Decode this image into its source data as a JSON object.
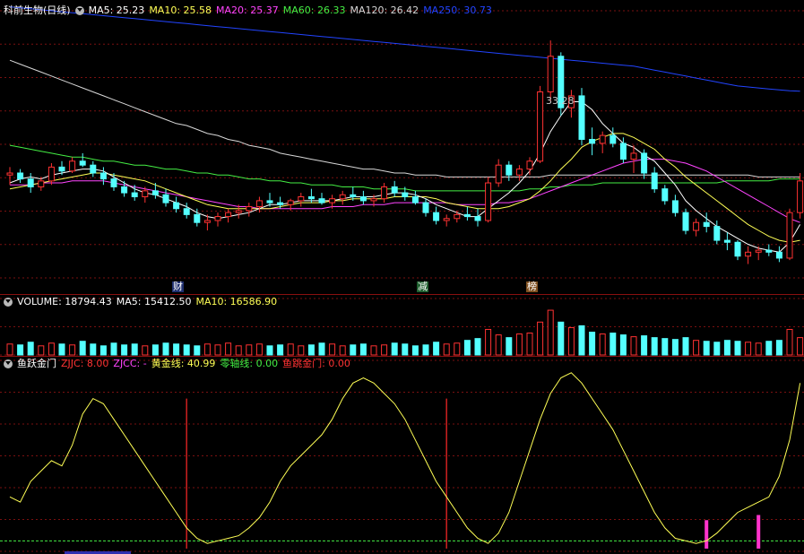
{
  "title": "科前生物(日线)",
  "ma_header": [
    {
      "label": "MA5: 25.23",
      "color": "#ffffff"
    },
    {
      "label": "MA10: 25.58",
      "color": "#ffff55"
    },
    {
      "label": "MA20: 25.37",
      "color": "#ff44ff"
    },
    {
      "label": "MA60: 26.33",
      "color": "#44ee44"
    },
    {
      "label": "MA120: 26.42",
      "color": "#d8d8d8"
    },
    {
      "label": "MA250: 30.73",
      "color": "#2244ff"
    }
  ],
  "volume_header": [
    {
      "label": "VOLUME: 18794.43",
      "color": "#ffffff"
    },
    {
      "label": "MA5: 15412.50",
      "color": "#ffffff"
    },
    {
      "label": "MA10: 16586.90",
      "color": "#ffff55"
    }
  ],
  "indicator_header": [
    {
      "label": "鱼跃金门",
      "color": "#ffffff"
    },
    {
      "label": "ZJJC: 8.00",
      "color": "#ff3333"
    },
    {
      "label": "ZJCC: -",
      "color": "#ff44ff"
    },
    {
      "label": "黄金线: 40.99",
      "color": "#ffff55"
    },
    {
      "label": "零轴线: 0.00",
      "color": "#44ee44"
    },
    {
      "label": "鱼跳金门: 0.00",
      "color": "#ff3333"
    }
  ],
  "high_label": "33.28",
  "events": [
    {
      "label": "财",
      "bg": "#1f2f6f",
      "color": "#ffffff"
    },
    {
      "label": "减",
      "bg": "#1f5f2f",
      "color": "#ffffff"
    },
    {
      "label": "榜",
      "bg": "#7f4f1f",
      "color": "#ffffff"
    }
  ],
  "colors": {
    "up": "#ff3232",
    "down": "#54ffff",
    "grid": "#7a1010",
    "ma5": "#ffffff",
    "ma10": "#ffff55",
    "ma20": "#ff44ff",
    "ma60": "#44ee44",
    "ma120": "#d8d8d8",
    "ma250": "#2244ff"
  },
  "chart_data": {
    "type": "candlestick",
    "price_range": [
      21.3,
      34.8
    ],
    "candles": [
      [
        26.5,
        26.9,
        26.0,
        26.6
      ],
      [
        26.6,
        26.8,
        26.1,
        26.3
      ],
      [
        26.3,
        26.6,
        25.6,
        25.9
      ],
      [
        25.9,
        26.4,
        25.7,
        26.2
      ],
      [
        26.2,
        27.1,
        26.0,
        26.9
      ],
      [
        26.9,
        27.2,
        26.5,
        26.7
      ],
      [
        26.7,
        27.4,
        26.6,
        27.2
      ],
      [
        27.2,
        27.6,
        26.9,
        27.0
      ],
      [
        27.0,
        27.2,
        26.4,
        26.6
      ],
      [
        26.6,
        26.9,
        26.0,
        26.3
      ],
      [
        26.3,
        26.6,
        25.7,
        25.9
      ],
      [
        25.9,
        26.2,
        25.4,
        25.6
      ],
      [
        25.6,
        26.0,
        25.2,
        25.4
      ],
      [
        25.4,
        25.9,
        25.1,
        25.7
      ],
      [
        25.7,
        26.1,
        25.3,
        25.5
      ],
      [
        25.5,
        25.8,
        24.9,
        25.1
      ],
      [
        25.1,
        25.4,
        24.6,
        24.8
      ],
      [
        24.8,
        25.1,
        24.3,
        24.5
      ],
      [
        24.5,
        24.8,
        23.9,
        24.1
      ],
      [
        24.1,
        24.5,
        23.7,
        24.2
      ],
      [
        24.2,
        24.6,
        23.9,
        24.4
      ],
      [
        24.4,
        24.8,
        24.1,
        24.6
      ],
      [
        24.6,
        25.0,
        24.3,
        24.7
      ],
      [
        24.7,
        25.1,
        24.4,
        24.9
      ],
      [
        24.9,
        25.4,
        24.6,
        25.2
      ],
      [
        25.2,
        25.6,
        24.9,
        25.1
      ],
      [
        25.1,
        25.4,
        24.8,
        25.0
      ],
      [
        25.0,
        25.3,
        24.7,
        25.2
      ],
      [
        25.2,
        25.6,
        24.9,
        25.4
      ],
      [
        25.4,
        25.8,
        25.1,
        25.3
      ],
      [
        25.3,
        25.6,
        25.0,
        25.1
      ],
      [
        25.1,
        25.5,
        24.8,
        25.3
      ],
      [
        25.3,
        25.7,
        25.0,
        25.5
      ],
      [
        25.5,
        25.9,
        25.2,
        25.4
      ],
      [
        25.4,
        25.7,
        25.0,
        25.2
      ],
      [
        25.2,
        25.5,
        24.9,
        25.3
      ],
      [
        25.3,
        26.1,
        25.1,
        25.9
      ],
      [
        25.9,
        26.2,
        25.4,
        25.6
      ],
      [
        25.6,
        25.9,
        25.2,
        25.4
      ],
      [
        25.4,
        25.7,
        25.0,
        25.1
      ],
      [
        25.1,
        25.3,
        24.4,
        24.6
      ],
      [
        24.6,
        24.9,
        24.0,
        24.2
      ],
      [
        24.2,
        24.5,
        23.9,
        24.3
      ],
      [
        24.3,
        24.7,
        24.1,
        24.5
      ],
      [
        24.5,
        24.9,
        24.2,
        24.4
      ],
      [
        24.4,
        24.8,
        23.9,
        24.2
      ],
      [
        24.2,
        26.4,
        24.1,
        26.1
      ],
      [
        26.1,
        27.3,
        25.9,
        27.0
      ],
      [
        27.0,
        27.2,
        26.2,
        26.5
      ],
      [
        26.5,
        27.0,
        26.2,
        26.8
      ],
      [
        26.8,
        27.4,
        26.5,
        27.2
      ],
      [
        27.2,
        31.0,
        27.1,
        30.7
      ],
      [
        30.7,
        33.3,
        30.2,
        32.5
      ],
      [
        32.5,
        32.7,
        29.5,
        29.9
      ],
      [
        29.9,
        30.8,
        29.4,
        30.5
      ],
      [
        30.5,
        30.9,
        28.0,
        28.3
      ],
      [
        28.3,
        28.9,
        27.5,
        28.1
      ],
      [
        28.1,
        28.7,
        27.6,
        28.5
      ],
      [
        28.5,
        28.9,
        27.9,
        28.1
      ],
      [
        28.1,
        28.4,
        27.1,
        27.3
      ],
      [
        27.3,
        28.0,
        26.6,
        27.6
      ],
      [
        27.6,
        27.8,
        26.3,
        26.6
      ],
      [
        26.6,
        26.9,
        25.6,
        25.8
      ],
      [
        25.8,
        26.0,
        25.0,
        25.2
      ],
      [
        25.2,
        25.5,
        24.4,
        24.6
      ],
      [
        24.6,
        24.8,
        23.5,
        23.7
      ],
      [
        23.7,
        24.3,
        23.4,
        24.1
      ],
      [
        24.1,
        24.6,
        23.6,
        23.9
      ],
      [
        23.9,
        24.2,
        23.0,
        23.2
      ],
      [
        23.2,
        23.6,
        22.7,
        23.1
      ],
      [
        23.1,
        23.2,
        22.2,
        22.4
      ],
      [
        22.4,
        22.9,
        22.0,
        22.6
      ],
      [
        22.6,
        22.9,
        22.2,
        22.7
      ],
      [
        22.7,
        23.0,
        22.4,
        22.6
      ],
      [
        22.6,
        22.9,
        22.1,
        22.3
      ],
      [
        22.3,
        24.8,
        22.2,
        24.6
      ],
      [
        24.6,
        26.6,
        24.3,
        26.2
      ]
    ],
    "ma5": [
      26.1,
      26.3,
      26.4,
      26.3,
      26.5,
      26.6,
      26.7,
      26.8,
      26.8,
      26.7,
      26.4,
      26.1,
      25.8,
      25.6,
      25.5,
      25.3,
      25.1,
      24.9,
      24.6,
      24.4,
      24.3,
      24.4,
      24.5,
      24.6,
      24.8,
      25.0,
      25.0,
      25.1,
      25.2,
      25.2,
      25.2,
      25.2,
      25.3,
      25.4,
      25.4,
      25.4,
      25.5,
      25.6,
      25.6,
      25.5,
      25.3,
      25.0,
      24.8,
      24.6,
      24.4,
      24.4,
      24.8,
      25.2,
      25.6,
      26.1,
      26.7,
      27.6,
      28.7,
      29.5,
      30.2,
      30.2,
      29.8,
      29.1,
      28.6,
      28.1,
      27.9,
      27.5,
      27.2,
      26.6,
      26.0,
      25.2,
      24.7,
      24.3,
      23.9,
      23.6,
      23.3,
      23.0,
      22.8,
      22.7,
      22.6,
      23.1,
      24.0
    ],
    "ma10": [
      25.8,
      25.9,
      26.0,
      26.1,
      26.2,
      26.3,
      26.4,
      26.5,
      26.6,
      26.6,
      26.5,
      26.4,
      26.3,
      26.2,
      26.0,
      25.8,
      25.6,
      25.4,
      25.2,
      25.0,
      24.9,
      24.8,
      24.8,
      24.8,
      24.8,
      24.8,
      24.9,
      25.0,
      25.1,
      25.1,
      25.1,
      25.2,
      25.2,
      25.3,
      25.3,
      25.3,
      25.3,
      25.4,
      25.4,
      25.4,
      25.4,
      25.3,
      25.1,
      25.0,
      24.9,
      24.8,
      24.8,
      24.8,
      24.9,
      25.1,
      25.3,
      25.7,
      26.2,
      26.8,
      27.3,
      27.9,
      28.2,
      28.4,
      28.6,
      28.6,
      28.4,
      28.1,
      27.8,
      27.3,
      26.9,
      26.4,
      26.0,
      25.6,
      25.2,
      24.8,
      24.4,
      24.0,
      23.7,
      23.4,
      23.2,
      23.1,
      23.2
    ],
    "ma20": [
      26.0,
      26.0,
      26.0,
      26.1,
      26.1,
      26.1,
      26.2,
      26.2,
      26.2,
      26.2,
      26.1,
      26.0,
      25.9,
      25.8,
      25.7,
      25.6,
      25.5,
      25.4,
      25.3,
      25.2,
      25.1,
      25.0,
      24.9,
      24.9,
      24.8,
      24.8,
      24.8,
      24.8,
      24.8,
      24.8,
      24.8,
      24.9,
      24.9,
      24.9,
      25.0,
      25.0,
      25.0,
      25.1,
      25.1,
      25.1,
      25.1,
      25.1,
      25.1,
      25.0,
      25.0,
      25.0,
      25.0,
      25.1,
      25.1,
      25.2,
      25.3,
      25.5,
      25.7,
      25.9,
      26.1,
      26.3,
      26.5,
      26.7,
      26.9,
      27.1,
      27.2,
      27.3,
      27.3,
      27.3,
      27.2,
      27.1,
      26.9,
      26.7,
      26.4,
      26.1,
      25.8,
      25.5,
      25.2,
      24.9,
      24.6,
      24.3,
      24.1
    ],
    "ma60": [
      28.0,
      27.9,
      27.8,
      27.7,
      27.6,
      27.5,
      27.4,
      27.4,
      27.3,
      27.2,
      27.2,
      27.1,
      27.0,
      27.0,
      26.9,
      26.8,
      26.8,
      26.7,
      26.6,
      26.6,
      26.5,
      26.5,
      26.4,
      26.3,
      26.3,
      26.2,
      26.2,
      26.1,
      26.1,
      26.0,
      26.0,
      26.0,
      25.9,
      25.9,
      25.9,
      25.8,
      25.8,
      25.8,
      25.8,
      25.7,
      25.7,
      25.7,
      25.7,
      25.7,
      25.7,
      25.7,
      25.7,
      25.7,
      25.7,
      25.7,
      25.8,
      25.8,
      25.9,
      25.9,
      26.0,
      26.0,
      26.0,
      26.1,
      26.1,
      26.1,
      26.1,
      26.1,
      26.1,
      26.1,
      26.1,
      26.1,
      26.1,
      26.1,
      26.1,
      26.2,
      26.2,
      26.2,
      26.2,
      26.2,
      26.3,
      26.3,
      26.3
    ],
    "ma120": [
      32.3,
      32.1,
      31.9,
      31.7,
      31.5,
      31.3,
      31.1,
      30.9,
      30.7,
      30.5,
      30.3,
      30.1,
      29.9,
      29.7,
      29.5,
      29.3,
      29.1,
      29.0,
      28.8,
      28.6,
      28.5,
      28.3,
      28.2,
      28.0,
      27.9,
      27.8,
      27.6,
      27.5,
      27.4,
      27.3,
      27.2,
      27.1,
      27.0,
      26.9,
      26.8,
      26.8,
      26.7,
      26.6,
      26.6,
      26.5,
      26.5,
      26.5,
      26.4,
      26.4,
      26.4,
      26.4,
      26.4,
      26.4,
      26.4,
      26.4,
      26.4,
      26.4,
      26.5,
      26.5,
      26.5,
      26.5,
      26.5,
      26.5,
      26.5,
      26.5,
      26.5,
      26.5,
      26.5,
      26.5,
      26.5,
      26.5,
      26.5,
      26.5,
      26.5,
      26.5,
      26.5,
      26.5,
      26.4,
      26.4,
      26.4,
      26.4,
      26.4
    ],
    "ma250": [
      35.0,
      34.95,
      34.9,
      34.85,
      34.8,
      34.75,
      34.7,
      34.65,
      34.6,
      34.55,
      34.5,
      34.45,
      34.4,
      34.35,
      34.3,
      34.25,
      34.2,
      34.15,
      34.1,
      34.05,
      34.0,
      33.95,
      33.9,
      33.85,
      33.8,
      33.75,
      33.7,
      33.65,
      33.6,
      33.55,
      33.5,
      33.45,
      33.4,
      33.35,
      33.3,
      33.25,
      33.2,
      33.15,
      33.1,
      33.05,
      33.0,
      32.95,
      32.9,
      32.85,
      32.8,
      32.75,
      32.7,
      32.65,
      32.6,
      32.55,
      32.5,
      32.45,
      32.4,
      32.35,
      32.3,
      32.25,
      32.2,
      32.15,
      32.1,
      32.05,
      32.0,
      31.9,
      31.8,
      31.7,
      31.6,
      31.5,
      31.4,
      31.3,
      31.2,
      31.1,
      31.0,
      30.95,
      30.9,
      30.85,
      30.8,
      30.76,
      30.73
    ],
    "volume": [
      1.2,
      1.1,
      1.4,
      1.0,
      1.3,
      1.2,
      1.1,
      1.5,
      1.2,
      1.0,
      1.3,
      1.1,
      1.2,
      1.0,
      1.1,
      1.3,
      1.2,
      1.1,
      1.0,
      1.2,
      1.1,
      1.3,
      1.0,
      1.1,
      1.2,
      1.0,
      1.1,
      1.2,
      1.0,
      1.1,
      1.3,
      1.2,
      1.0,
      1.1,
      1.2,
      1.0,
      1.1,
      1.3,
      1.2,
      1.0,
      1.1,
      1.4,
      1.2,
      1.3,
      1.6,
      1.8,
      2.8,
      2.2,
      1.9,
      2.3,
      2.4,
      3.6,
      4.9,
      3.6,
      3.0,
      3.2,
      2.5,
      2.3,
      2.4,
      2.2,
      2.0,
      2.1,
      1.9,
      1.8,
      1.7,
      1.9,
      1.6,
      1.5,
      1.4,
      1.6,
      1.5,
      1.4,
      1.3,
      1.5,
      1.6,
      2.8,
      1.9
    ],
    "indicator_line": [
      20,
      18,
      26,
      30,
      34,
      32,
      40,
      52,
      58,
      56,
      50,
      44,
      38,
      32,
      26,
      20,
      14,
      8,
      4,
      2,
      3,
      4,
      5,
      8,
      12,
      18,
      26,
      32,
      36,
      40,
      44,
      50,
      58,
      64,
      66,
      64,
      60,
      56,
      50,
      42,
      34,
      26,
      20,
      14,
      8,
      4,
      2,
      6,
      14,
      26,
      38,
      50,
      60,
      66,
      68,
      64,
      58,
      52,
      46,
      38,
      30,
      22,
      14,
      8,
      4,
      3,
      2,
      3,
      6,
      10,
      14,
      16,
      18,
      20,
      28,
      42,
      64
    ]
  }
}
